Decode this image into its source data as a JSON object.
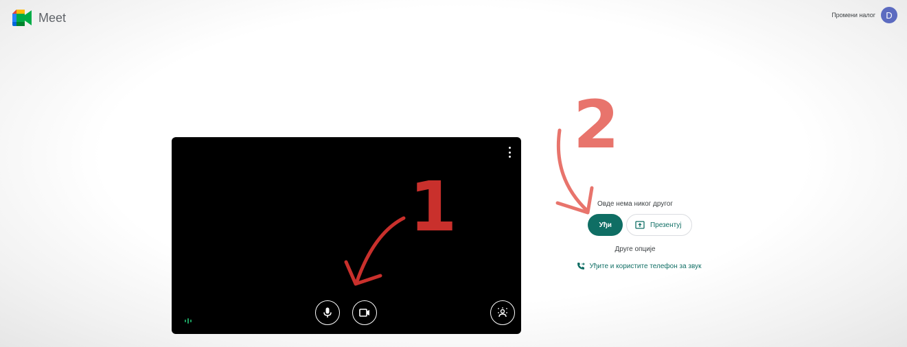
{
  "app": {
    "name": "Meet",
    "brand_colors": {
      "green": "#00832d",
      "blue": "#0066da",
      "yellow": "#ffba00",
      "red": "#e94235",
      "teal": "#0f6e64"
    }
  },
  "account": {
    "email": "",
    "switch_label": "Промени налог",
    "avatar_letter": "D",
    "avatar_color": "#5c6bc0"
  },
  "preview": {
    "menu_icon": "more-vert-icon",
    "mic_icon": "microphone-icon",
    "camera_icon": "camera-icon",
    "effects_icon": "visual-effects-icon",
    "audio_indicator_icon": "audio-level-icon"
  },
  "join": {
    "meeting_name": "",
    "status": "Овде нема никог другог",
    "join_label": "Уђи",
    "present_label": "Презентуј",
    "other_options": "Друге опције",
    "phone_label": "Уђите и користите телефон за звук"
  },
  "annotations": {
    "step1": "1",
    "step2": "2"
  }
}
